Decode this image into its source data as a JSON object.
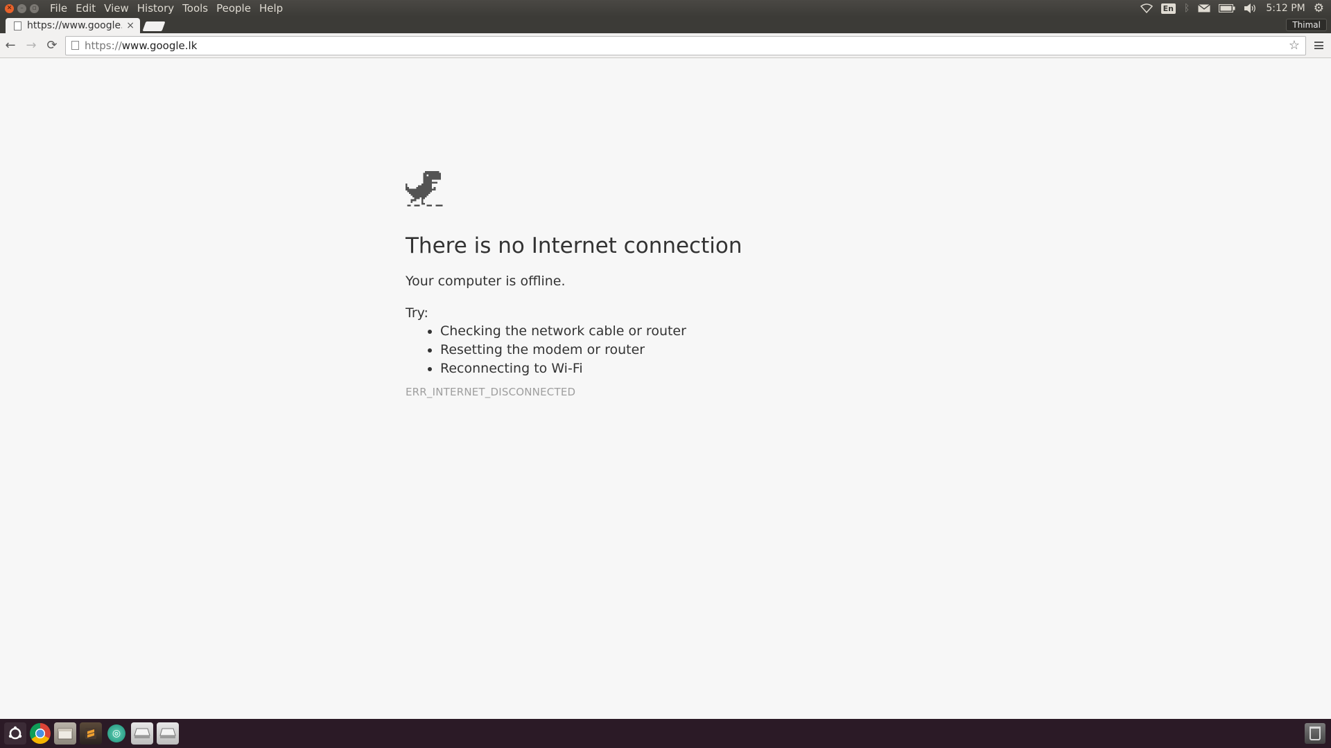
{
  "system_panel": {
    "menus": [
      "File",
      "Edit",
      "View",
      "History",
      "Tools",
      "People",
      "Help"
    ],
    "keyboard_layout": "En",
    "clock": "5:12 PM",
    "indicator_icons": [
      "wifi-icon",
      "keyboard-layout-icon",
      "bluetooth-icon",
      "mail-icon",
      "battery-icon",
      "volume-icon",
      "settings-gear-icon"
    ]
  },
  "tabs": [
    {
      "title": "https://www.google.lk",
      "close": "×"
    }
  ],
  "profile": {
    "name": "Thimal"
  },
  "toolbar": {
    "back": "←",
    "forward": "→",
    "reload": "⟳",
    "url_scheme": "https://",
    "url_host": "www.google.lk",
    "star": "☆"
  },
  "error_page": {
    "title": "There is no Internet connection",
    "description": "Your computer is offline.",
    "try_label": "Try:",
    "suggestions": [
      "Checking the network cable or router",
      "Resetting the modem or router",
      "Reconnecting to Wi-Fi"
    ],
    "error_code": "ERR_INTERNET_DISCONNECTED"
  },
  "launcher": {
    "apps": [
      "dash-icon",
      "chrome-icon",
      "files-icon",
      "sublime-text-icon",
      "globe-app-icon",
      "drive-icon",
      "drive-icon"
    ]
  }
}
